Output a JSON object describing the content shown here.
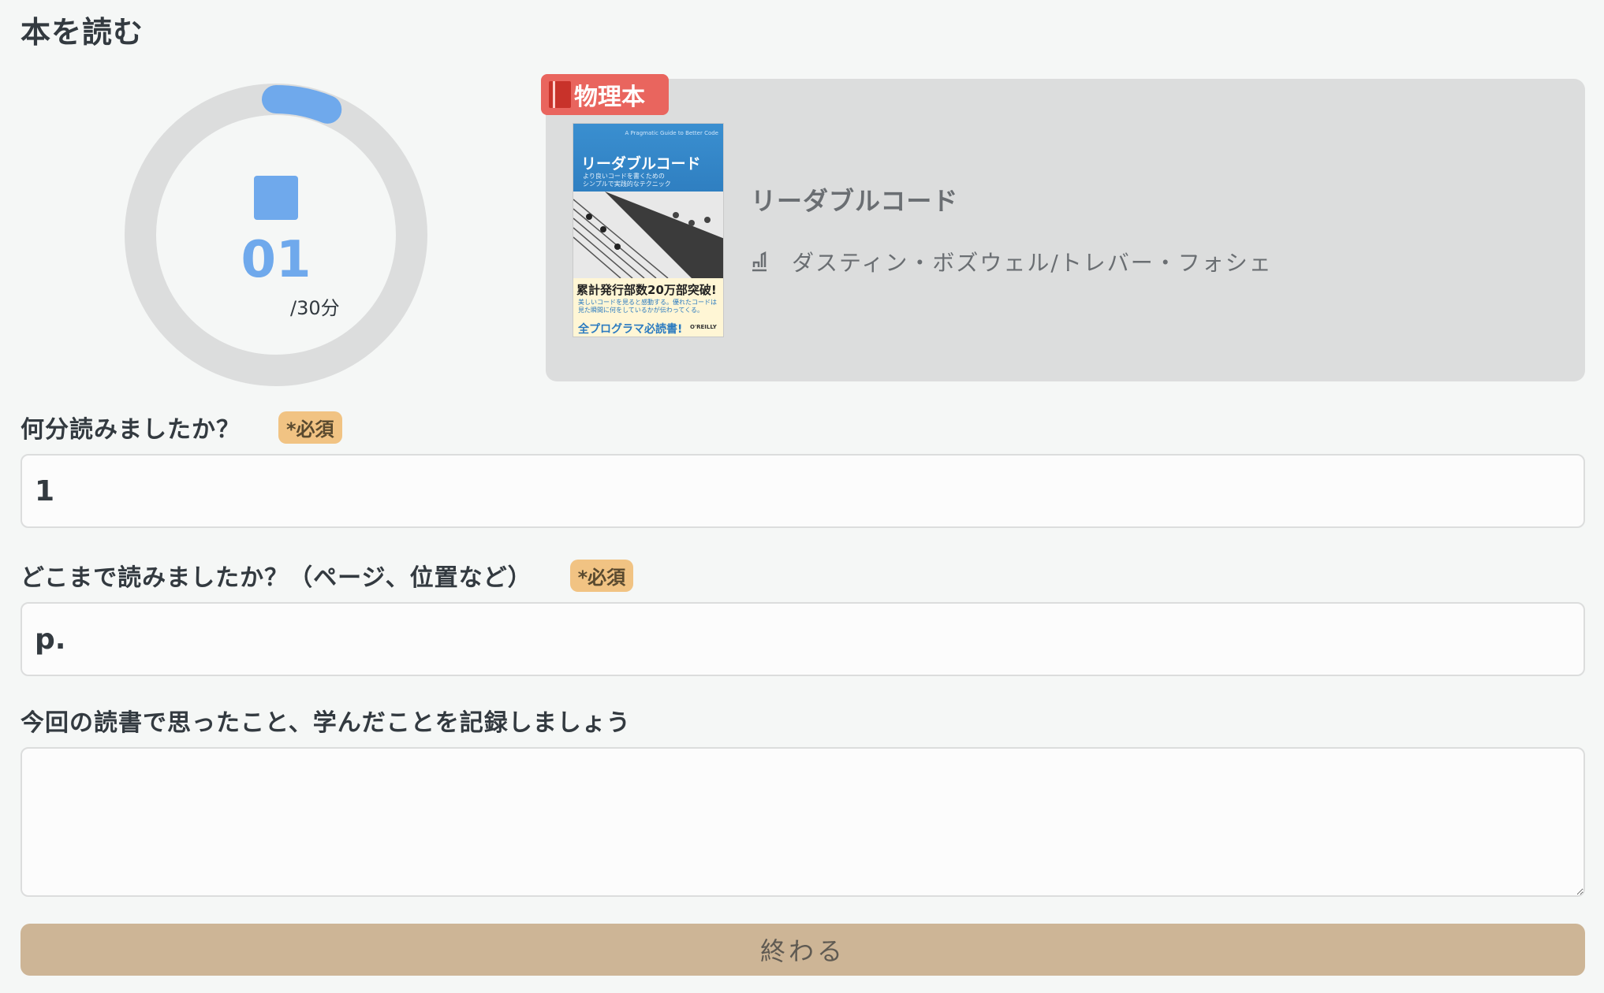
{
  "page": {
    "title": "本を読む"
  },
  "timer": {
    "elapsed_label": "01",
    "target_label": "/30分",
    "progress": 0.0333,
    "colors": {
      "track": "#dcdddd",
      "progress": "#6fa9ec"
    }
  },
  "book": {
    "type_label": "物理本",
    "title": "リーダブルコード",
    "author": "ダスティン・ボズウェル/トレバー・フォシェ",
    "cover": {
      "series": "A Pragmatic Guide to Better Code",
      "title": "リーダブルコード",
      "subtitle_lines": [
        "より良いコードを書くための",
        "シンプルで実践的なテクニック"
      ],
      "claim": "累計発行部数20万部突破!",
      "blurb_lines": [
        "美しいコードを見ると感動する。優れたコードは",
        "見た瞬間に何をしているかが伝わってくる。"
      ],
      "must_read": "全プログラマ必読書!",
      "publisher": "O'REILLY"
    }
  },
  "form": {
    "minutes": {
      "label": "何分読みましたか？",
      "required": "*必須",
      "value": "1"
    },
    "position": {
      "label": "どこまで読みましたか？（ページ、位置など）",
      "required": "*必須",
      "value": "p."
    },
    "notes": {
      "label": "今回の読書で思ったこと、学んだことを記録しましょう",
      "value": ""
    },
    "submit_label": "終わる"
  }
}
